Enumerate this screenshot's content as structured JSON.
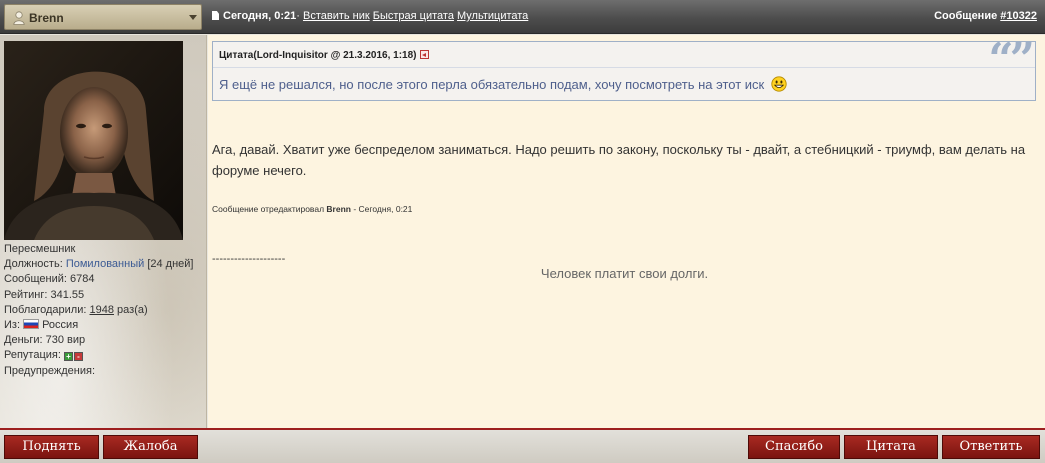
{
  "header": {
    "author": "Brenn",
    "date": "Сегодня, 0:21",
    "separator": "·",
    "links": {
      "insert_nick": "Вставить ник",
      "fast_quote": "Быстрая цитата",
      "multi_quote": "Мультицитата"
    },
    "message_label": "Сообщение",
    "message_number": "#10322"
  },
  "user": {
    "title": "Пересмешник",
    "position_label": "Должность:",
    "position_value": "Помилованный",
    "position_extra": "[24 дней]",
    "messages": "Сообщений: 6784",
    "rating": "Рейтинг: 341.55",
    "thanks_label": "Поблагодарили:",
    "thanks_count": "1948",
    "thanks_suffix": "раз(а)",
    "from_label": "Из:",
    "country": "Россия",
    "money": "Деньги: 730 вир",
    "reputation_label": "Репутация:",
    "rep_plus": "+",
    "rep_minus": "-",
    "warnings": "Предупреждения:"
  },
  "post": {
    "quote_title": "Цитата(Lord-Inquisitor @ 21.3.2016, 1:18)",
    "quote_text": "Я ещё не решался, но после этого перла обязательно подам, хочу посмотреть на этот иск",
    "body": "Ага, давай. Хватит уже беспределом заниматься. Надо решить по закону, поскольку ты - двайт, а стебницкий - триумф, вам делать на форуме нечего.",
    "edited_prefix": "Сообщение отредактировал",
    "edited_user": "Brenn",
    "edited_time": "- Сегодня, 0:21",
    "sig_separator": "--------------------",
    "signature": "Человек платит свои долги."
  },
  "buttons": {
    "up": "Поднять",
    "complaint": "Жалоба",
    "thanks": "Спасибо",
    "quote": "Цитата",
    "reply": "Ответить"
  },
  "colors": {
    "header_bg": "#4d4d4d",
    "post_bg": "#fdf4e0",
    "quote_border": "#9fb0c7",
    "quote_text": "#4e5f8c",
    "link_blue": "#3c5b94",
    "button_red": "#8f1d17"
  },
  "icons": {
    "author": "user-icon",
    "date": "document-icon",
    "quote_back": "back-arrow-icon",
    "quote_marks": "quote-marks-icon",
    "smiley": "smiley-icon",
    "flag": "russia-flag-icon"
  }
}
